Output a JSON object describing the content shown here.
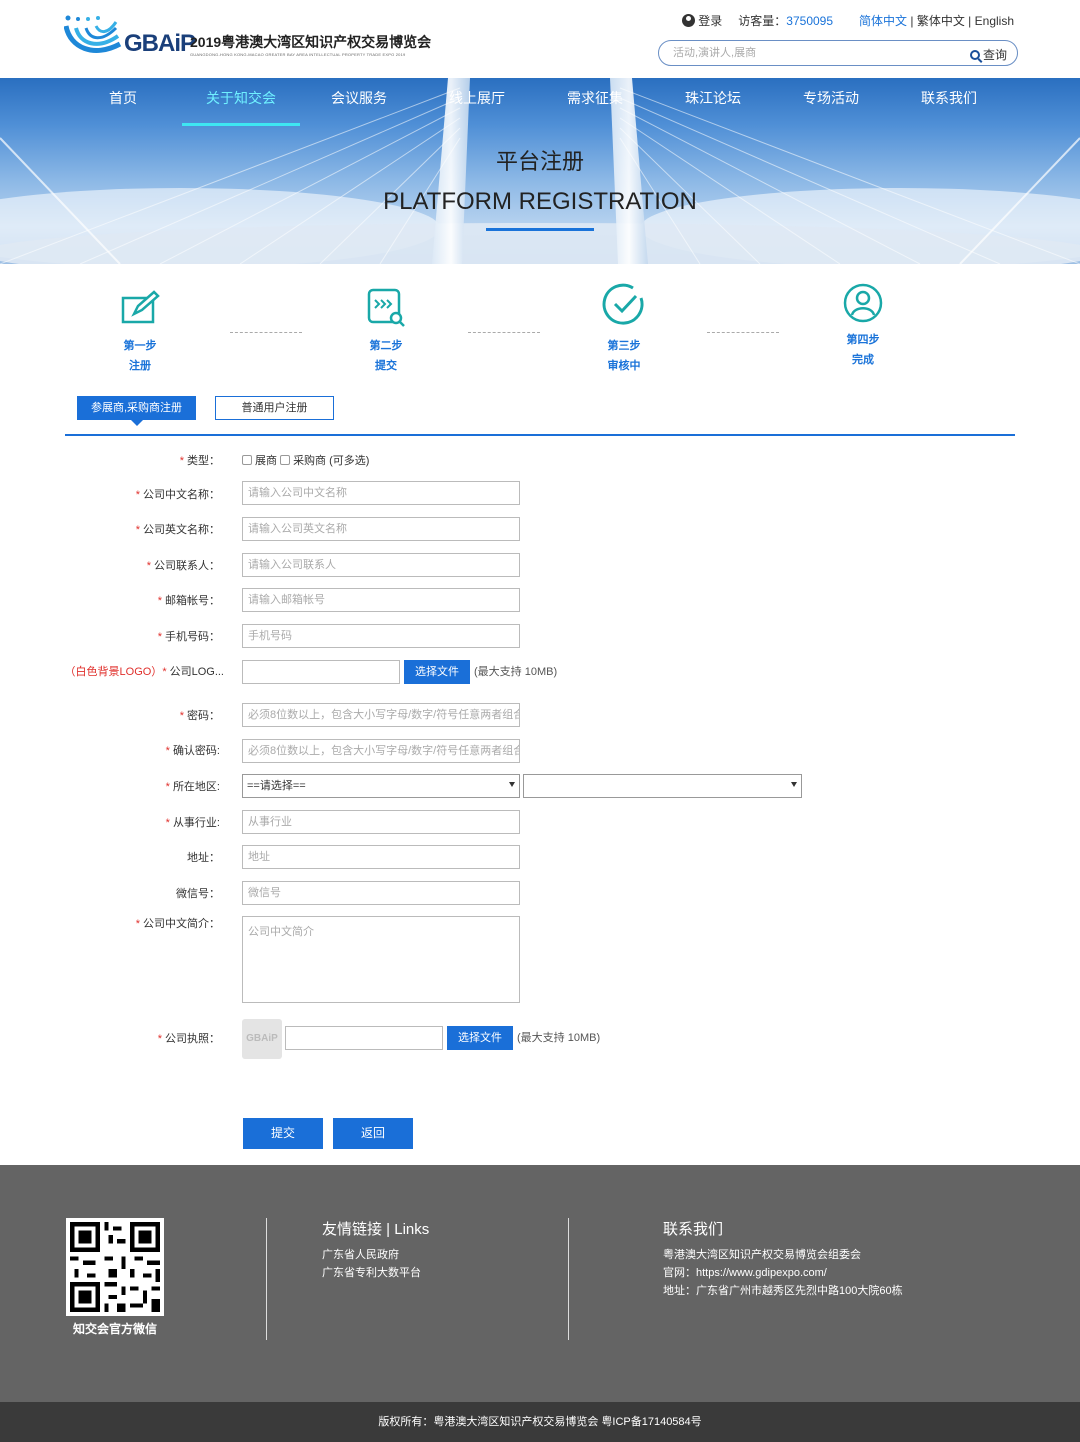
{
  "brand": {
    "logo_text": "GBAiP",
    "title": "2019粤港澳大湾区知识产权交易博览会",
    "subtitle": "GUANGDONG-HONG KONG-MACAO GREATER BAY AREA INTELLECTUAL PROPERTY TRADE EXPO 2019"
  },
  "topbar": {
    "login": "登录",
    "visits_label": "访客量：",
    "visits_count": "3750095",
    "lang_simplified": "简体中文",
    "lang_sep1": " | ",
    "lang_traditional": "繁体中文",
    "lang_sep2": " | ",
    "lang_english": "English"
  },
  "search": {
    "placeholder": "活动,演讲人,展商",
    "button": "查询"
  },
  "nav": [
    "首页",
    "关于知交会",
    "会议服务",
    "线上展厅",
    "需求征集",
    "珠江论坛",
    "专场活动",
    "联系我们"
  ],
  "nav_active_index": 1,
  "banner": {
    "title_cn": "平台注册",
    "title_en": "PLATFORM REGISTRATION"
  },
  "steps": [
    {
      "step": "第一步",
      "name": "注册",
      "icon": "edit-icon"
    },
    {
      "step": "第二步",
      "name": "提交",
      "icon": "submit-search-icon"
    },
    {
      "step": "第三步",
      "name": "审核中",
      "icon": "check-circle-icon"
    },
    {
      "step": "第四步",
      "name": "完成",
      "icon": "user-circle-icon"
    }
  ],
  "tabs": {
    "exhibitor": "参展商,采购商注册",
    "user": "普通用户注册"
  },
  "form": {
    "type_label": "类型：",
    "type_options": [
      "展商",
      "采购商 (可多选)"
    ],
    "company_cn_label": "公司中文名称：",
    "company_cn_placeholder": "请输入公司中文名称",
    "company_en_label": "公司英文名称：",
    "company_en_placeholder": "请输入公司英文名称",
    "contact_label": "公司联系人：",
    "contact_placeholder": "请输入公司联系人",
    "email_label": "邮箱帐号：",
    "email_placeholder": "请输入邮箱帐号",
    "phone_label": "手机号码：",
    "phone_placeholder": "手机号码",
    "logo_label_note": "（白色背景LOGO）",
    "logo_label": "公司LOG...",
    "choose_file": "选择文件",
    "max_size": "(最大支持 10MB)",
    "password_label": "密码：",
    "password_placeholder": "必须8位数以上，包含大小写字母/数字/符号任意两者组合",
    "confirm_label": "确认密码:",
    "confirm_placeholder": "必须8位数以上，包含大小写字母/数字/符号任意两者组合",
    "region_label": "所在地区:",
    "region_selected": "==请选择==",
    "region_second": "",
    "industry_label": "从事行业:",
    "industry_placeholder": "从事行业",
    "address_label": "地址：",
    "address_placeholder": "地址",
    "wechat_label": "微信号：",
    "wechat_placeholder": "微信号",
    "intro_label": "公司中文简介：",
    "intro_placeholder": "公司中文简介",
    "license_label": "公司执照：",
    "license_thumb": "GBAiP",
    "submit": "提交",
    "back": "返回"
  },
  "footer": {
    "qr_caption": "知交会官方微信",
    "links_title": "友情链接 | Links",
    "links": [
      "广东省人民政府",
      "广东省专利大数平台"
    ],
    "contact_title": "联系我们",
    "contact_lines": [
      "粤港澳大湾区知识产权交易博览会组委会",
      "官网：https://www.gdipexpo.com/",
      "地址：广东省广州市越秀区先烈中路100大院60栋"
    ],
    "copyright": "版权所有：粤港澳大湾区知识产权交易博览会 粤ICP备17140584号"
  },
  "colors": {
    "accent": "#1a6fd8",
    "nav_active": "#6ff0ff",
    "required": "#e0302c",
    "footer_bg": "#646464",
    "copyright_bg": "#3a3a3a"
  }
}
